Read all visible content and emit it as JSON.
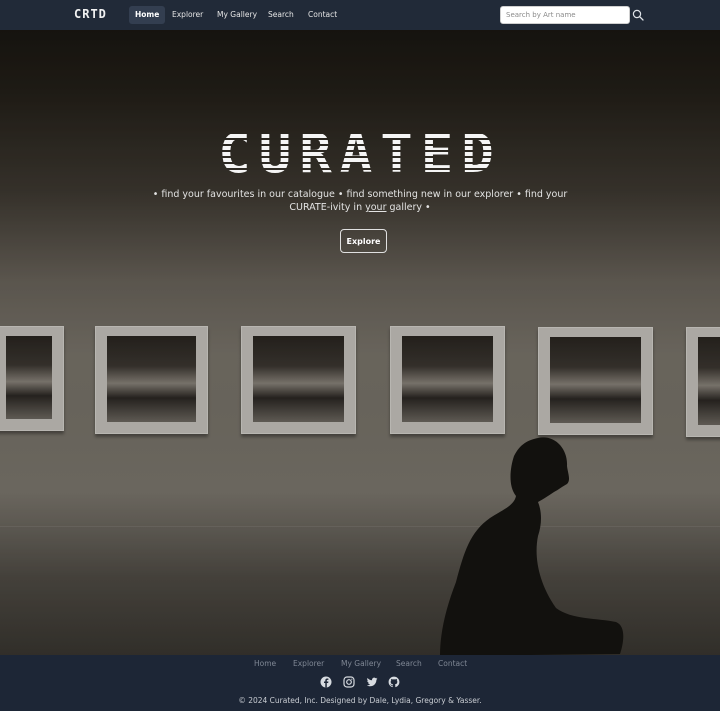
{
  "navbar": {
    "brand": "CRTD",
    "links": [
      {
        "label": "Home",
        "active": true
      },
      {
        "label": "Explorer",
        "active": false
      },
      {
        "label": "My Gallery",
        "active": false
      },
      {
        "label": "Search",
        "active": false
      },
      {
        "label": "Contact",
        "active": false
      }
    ],
    "search": {
      "placeholder": "Search by Art name",
      "value": "",
      "icon": "search-icon"
    }
  },
  "hero": {
    "title": "CURATED",
    "tagline_part1": "• find your favourites in our catalogue • find something new in our explorer • find your CURATE-ivity in ",
    "tagline_emphasis": "your",
    "tagline_part2": " gallery •",
    "cta_label": "Explore"
  },
  "footer": {
    "links": [
      "Home",
      "Explorer",
      "My Gallery",
      "Search",
      "Contact"
    ],
    "social_icons": [
      "facebook-icon",
      "instagram-icon",
      "twitter-icon",
      "github-icon"
    ],
    "copyright": "© 2024 Curated, Inc. Designed by Dale, Lydia, Gregory & Yasser."
  },
  "colors": {
    "navbar_bg": "#212a38",
    "footer_bg": "#1d2636",
    "text_light": "#ffffff"
  }
}
